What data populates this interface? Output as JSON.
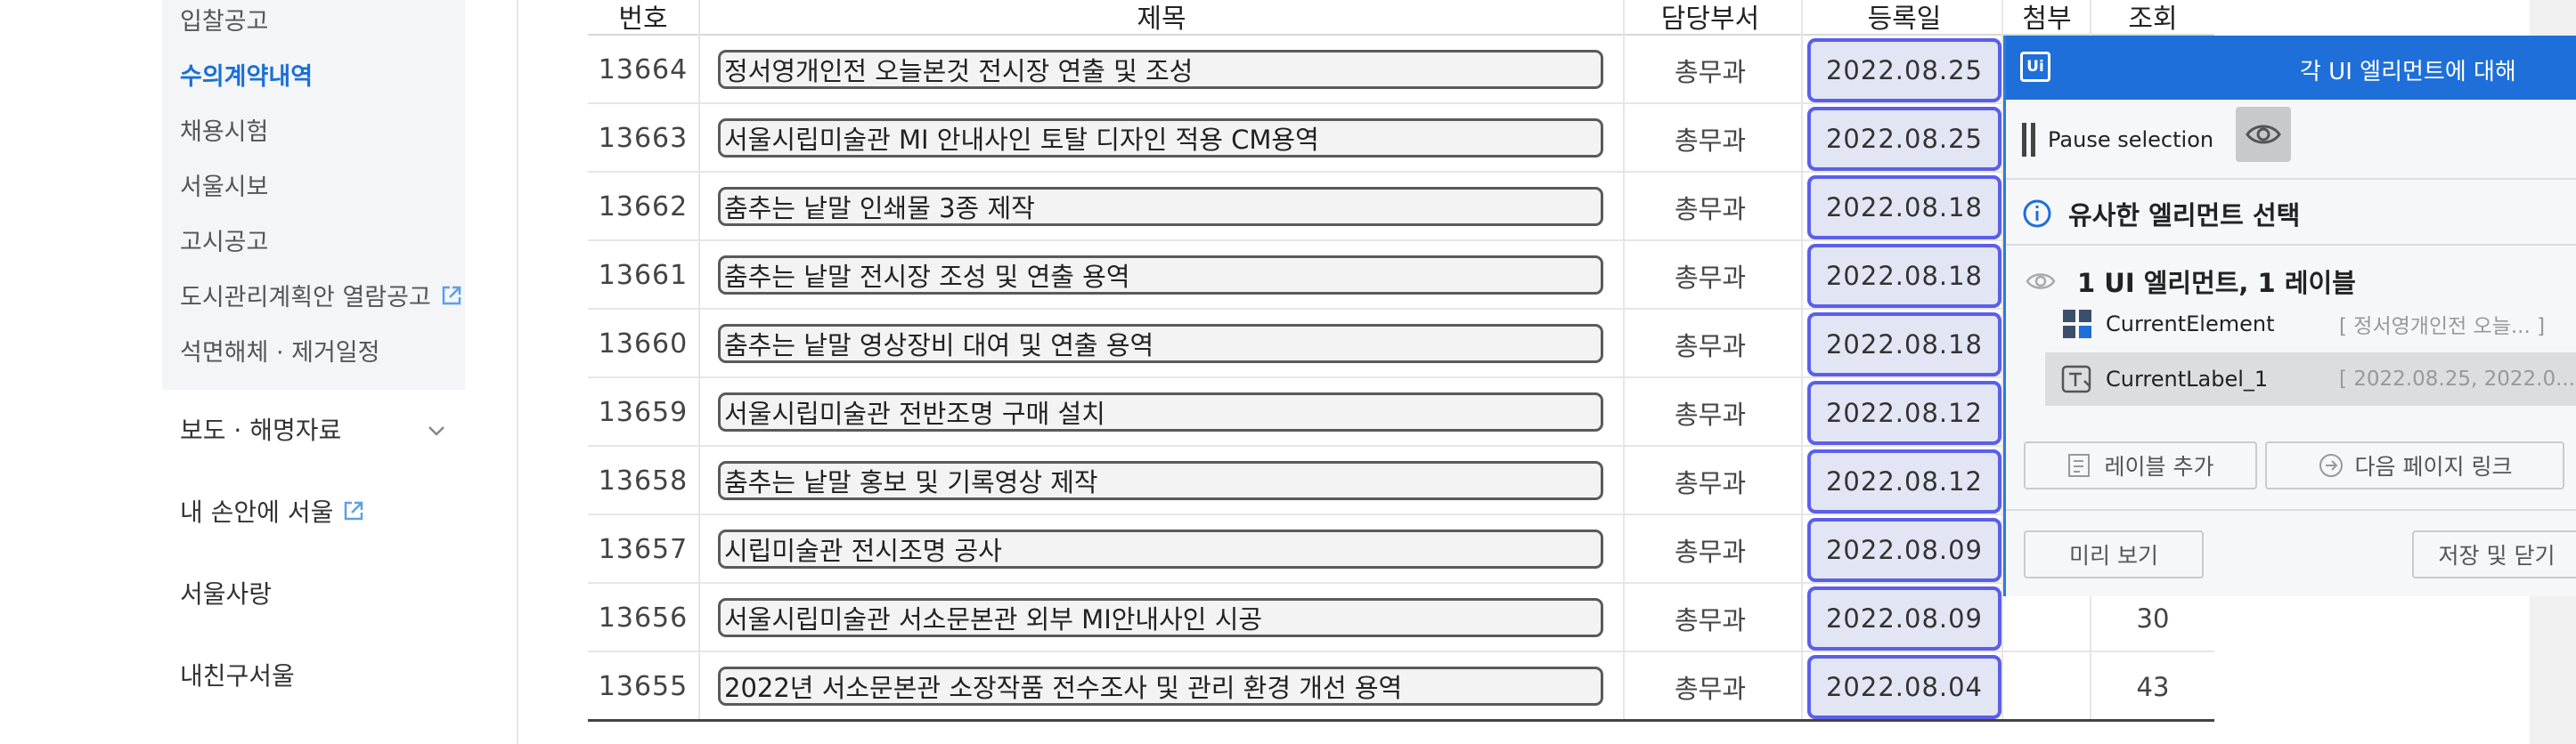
{
  "sidebar": {
    "submenu": [
      {
        "label": "입찰공고",
        "active": false,
        "external": false
      },
      {
        "label": "수의계약내역",
        "active": true,
        "external": false
      },
      {
        "label": "채용시험",
        "active": false,
        "external": false
      },
      {
        "label": "서울시보",
        "active": false,
        "external": false
      },
      {
        "label": "고시공고",
        "active": false,
        "external": false
      },
      {
        "label": "도시관리계획안 열람공고",
        "active": false,
        "external": true
      },
      {
        "label": "석면해체 · 제거일정",
        "active": false,
        "external": false
      }
    ],
    "main": [
      {
        "label": "보도 · 해명자료",
        "expandable": true,
        "external": false
      },
      {
        "label": "내 손안에 서울",
        "expandable": false,
        "external": true
      },
      {
        "label": "서울사랑",
        "expandable": false,
        "external": false
      },
      {
        "label": "내친구서울",
        "expandable": false,
        "external": false
      }
    ],
    "active_color": "#1a6fd8"
  },
  "table": {
    "headers": {
      "number": "번호",
      "title": "제목",
      "department": "담당부서",
      "date": "등록일",
      "attachment": "첨부",
      "views": "조회"
    },
    "rows": [
      {
        "number": "13664",
        "title": "정서영개인전 오늘본것 전시장 연출 및 조성",
        "department": "총무과",
        "date": "2022.08.25",
        "views": ""
      },
      {
        "number": "13663",
        "title": "서울시립미술관 MI 안내사인 토탈 디자인 적용 CM용역",
        "department": "총무과",
        "date": "2022.08.25",
        "views": ""
      },
      {
        "number": "13662",
        "title": "춤추는 낱말 인쇄물 3종 제작",
        "department": "총무과",
        "date": "2022.08.18",
        "views": ""
      },
      {
        "number": "13661",
        "title": "춤추는 낱말 전시장 조성 및 연출 용역",
        "department": "총무과",
        "date": "2022.08.18",
        "views": ""
      },
      {
        "number": "13660",
        "title": "춤추는 낱말 영상장비 대여 및 연출 용역",
        "department": "총무과",
        "date": "2022.08.18",
        "views": ""
      },
      {
        "number": "13659",
        "title": "서울시립미술관 전반조명 구매 설치",
        "department": "총무과",
        "date": "2022.08.12",
        "views": ""
      },
      {
        "number": "13658",
        "title": "춤추는 낱말 홍보 및 기록영상 제작",
        "department": "총무과",
        "date": "2022.08.12",
        "views": ""
      },
      {
        "number": "13657",
        "title": "시립미술관 전시조명 공사",
        "department": "총무과",
        "date": "2022.08.09",
        "views": ""
      },
      {
        "number": "13656",
        "title": "서울시립미술관 서소문본관 외부 MI안내사인 시공",
        "department": "총무과",
        "date": "2022.08.09",
        "views": "30"
      },
      {
        "number": "13655",
        "title": "2022년 서소문본관 소장작품 전수조사 및 관리 환경 개선 용역",
        "department": "총무과",
        "date": "2022.08.04",
        "views": "43"
      }
    ],
    "date_highlight_color": "#5b5fe8"
  },
  "overlay": {
    "logo": "Ui",
    "title": "각 UI 엘리먼트에 대해",
    "pause_label": "Pause selection",
    "similar_label": "유사한 엘리먼트 선택",
    "summary": "1 UI 엘리먼트, 1 레이블",
    "items": [
      {
        "name": "CurrentElement",
        "value": "[ 정서영개인전 오늘...  ]",
        "icon": "grid-icon"
      },
      {
        "name": "CurrentLabel_1",
        "value": "[ 2022.08.25, 2022.0...  ]",
        "icon": "text-label-icon"
      }
    ],
    "add_label_button": "레이블 추가",
    "next_page_button": "다음 페이지 링크",
    "preview_button": "미리 보기",
    "save_close_button": "저장 및 닫기",
    "header_color": "#1e6fd9"
  }
}
